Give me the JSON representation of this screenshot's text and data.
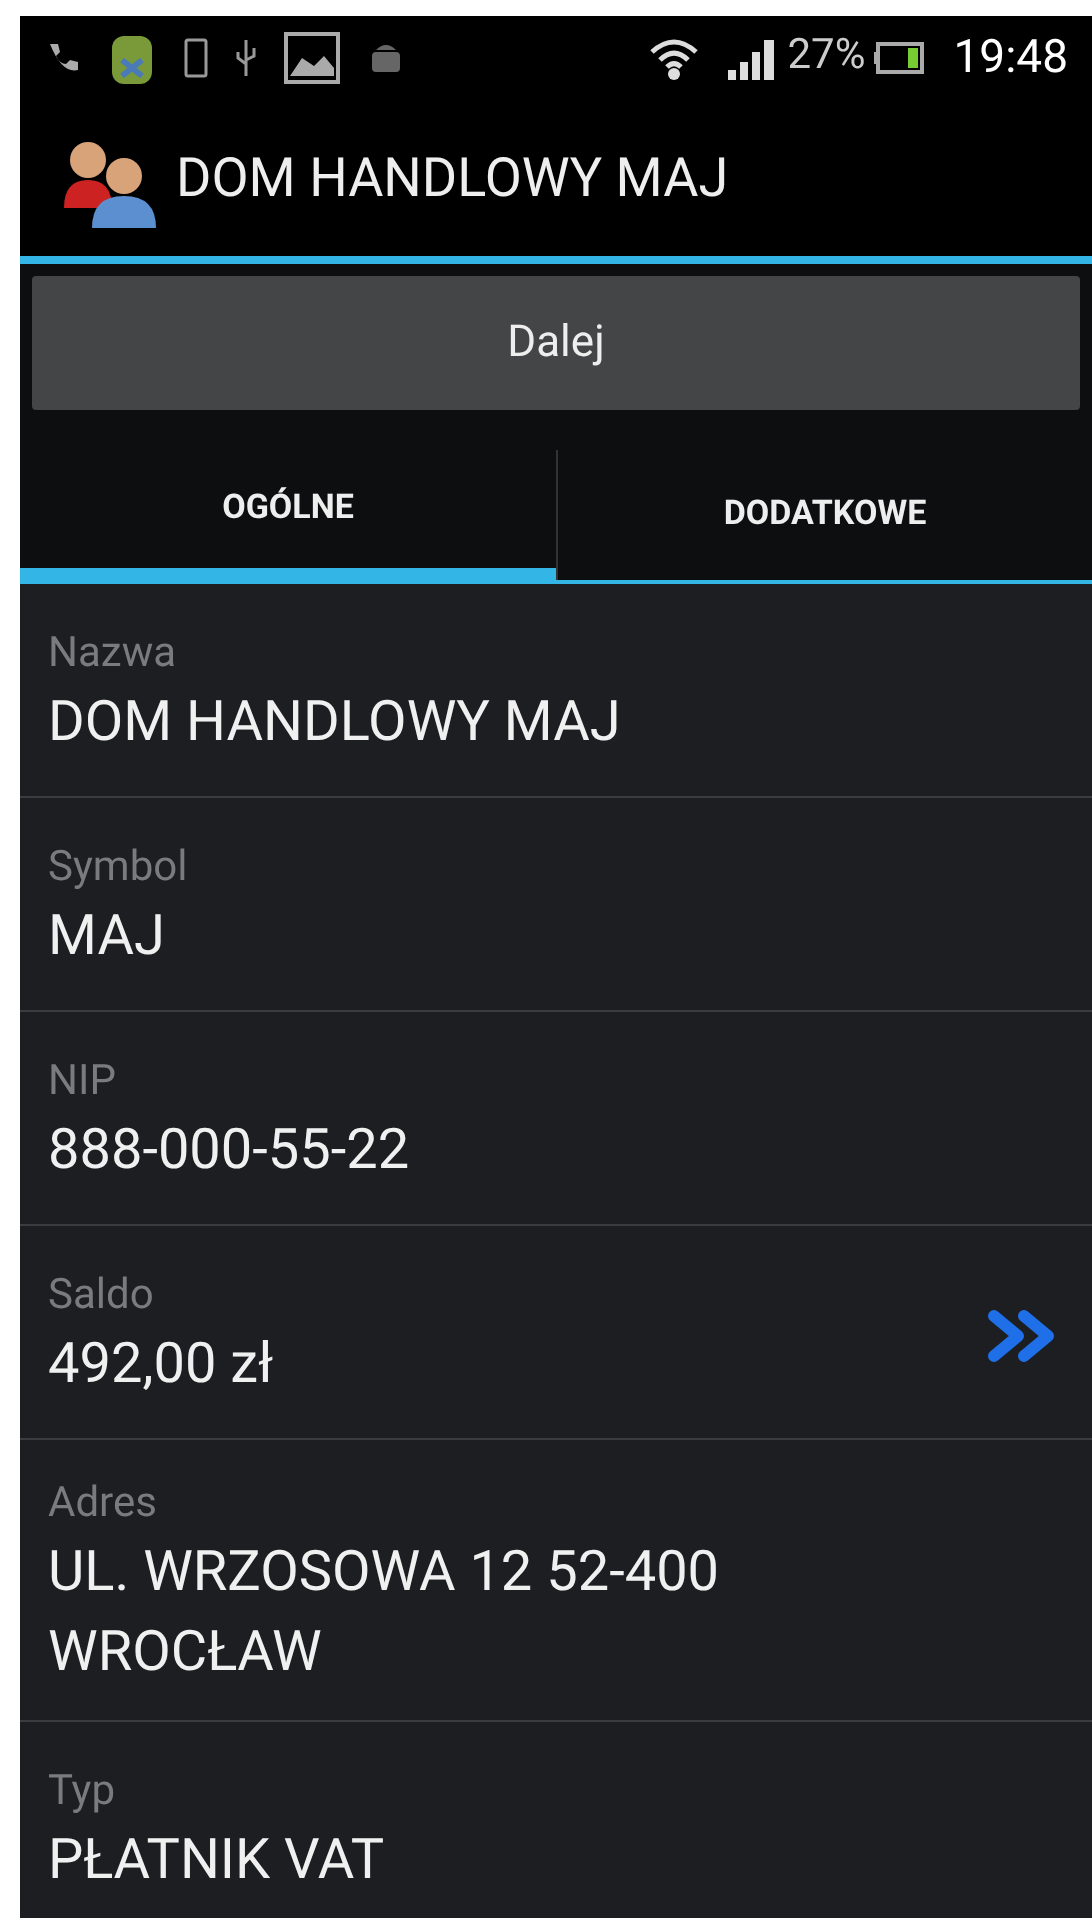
{
  "status_bar": {
    "battery_percent": "27%",
    "time": "19:48"
  },
  "action_bar": {
    "title": "DOM HANDLOWY MAJ"
  },
  "button": {
    "label": "Dalej"
  },
  "tabs": [
    {
      "label": "OGÓLNE",
      "selected": true
    },
    {
      "label": "DODATKOWE",
      "selected": false
    }
  ],
  "fields": [
    {
      "label": "Nazwa",
      "value": "DOM HANDLOWY MAJ",
      "has_link": false
    },
    {
      "label": "Symbol",
      "value": "MAJ",
      "has_link": false
    },
    {
      "label": "NIP",
      "value": "888-000-55-22",
      "has_link": false
    },
    {
      "label": "Saldo",
      "value": "492,00 zł",
      "has_link": true
    },
    {
      "label": "Adres",
      "value": "UL. WRZOSOWA 12 52-400 WROCŁAW",
      "has_link": false
    },
    {
      "label": "Typ",
      "value": "PŁATNIK VAT",
      "has_link": false
    }
  ]
}
